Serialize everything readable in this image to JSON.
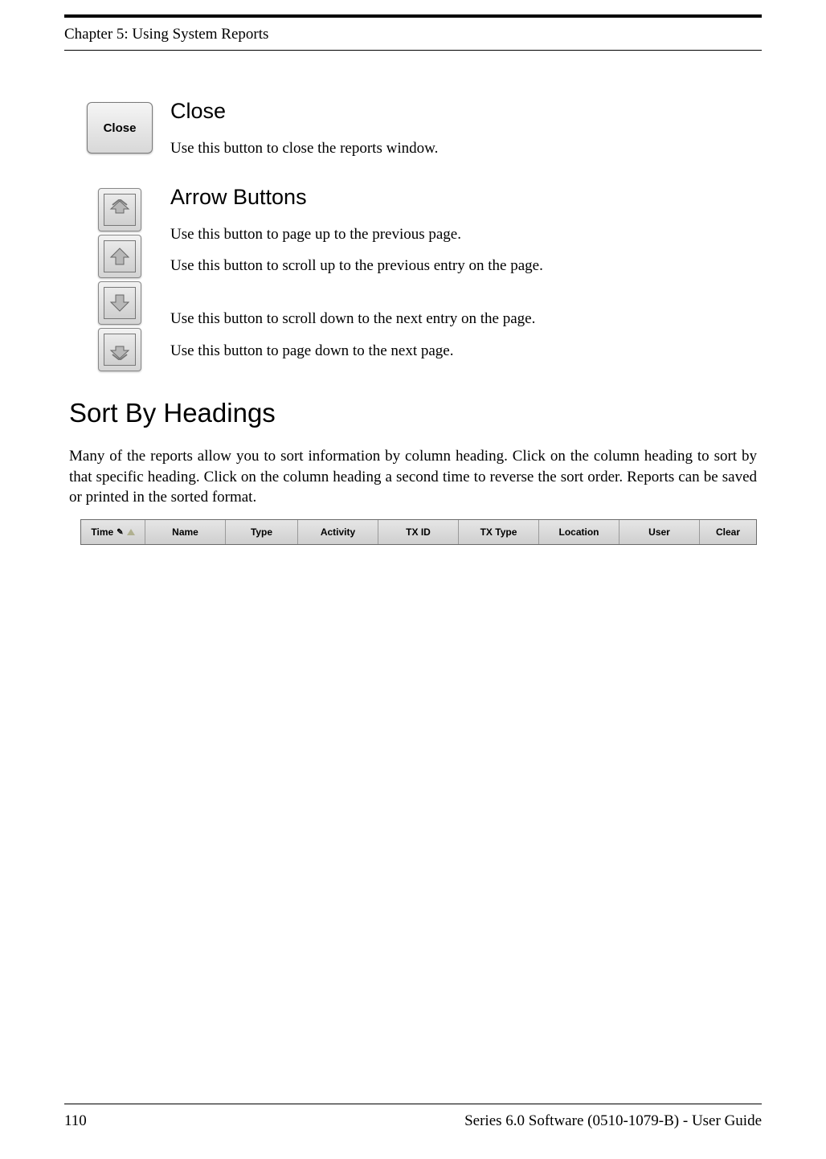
{
  "chapter_header": "Chapter 5: Using System Reports",
  "close_section": {
    "heading": "Close",
    "button_label": "Close",
    "desc": "Use this button to close the reports window."
  },
  "arrow_section": {
    "heading": "Arrow Buttons",
    "page_up_desc": "Use this button to page up to the previous page.",
    "scroll_up_desc": "Use this button to scroll up to the previous entry on the page.",
    "scroll_down_desc": "Use this button to scroll down to the next entry on the page.",
    "page_down_desc": "Use this button to page down to the next page."
  },
  "sort_section": {
    "heading": "Sort By Headings",
    "para": "Many of the reports allow you to sort information by column heading. Click on the column heading to sort by that specific heading. Click on the column heading a second time to reverse the sort order. Reports can be saved or printed in the sorted format.",
    "columns": [
      "Time",
      "Name",
      "Type",
      "Activity",
      "TX ID",
      "TX Type",
      "Location",
      "User",
      "Clear"
    ]
  },
  "footer": {
    "page_number": "110",
    "doc_title": "Series 6.0 Software (0510-1079-B) - User Guide"
  }
}
